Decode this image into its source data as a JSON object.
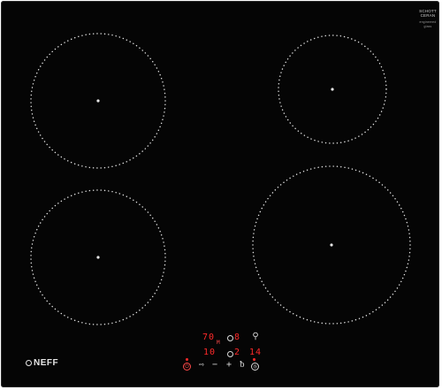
{
  "appliance": {
    "brand": "NEFF",
    "badge_line1": "SCHOTT",
    "badge_line2": "CERAN",
    "badge_sub": "engineered glass"
  },
  "zones": [
    {
      "id": "front-left"
    },
    {
      "id": "rear-right"
    },
    {
      "id": "rear-left"
    },
    {
      "id": "front-right"
    }
  ],
  "controls": {
    "display_top_left": "70",
    "display_top_right": "8",
    "display_bottom_left": "10",
    "display_bottom_mid": "2",
    "display_bottom_right": "14",
    "timer_unit": "M",
    "minus_label": "−",
    "plus_label": "+",
    "arrow_label": "⇨",
    "icons": [
      "power-icon",
      "child-lock-icon",
      "timer-icon",
      "minus-icon",
      "plus-icon",
      "select-arrow-icon"
    ],
    "colors": {
      "display": "#ff2a2a",
      "glass": "#050505",
      "marking": "#e0e0e0"
    }
  }
}
